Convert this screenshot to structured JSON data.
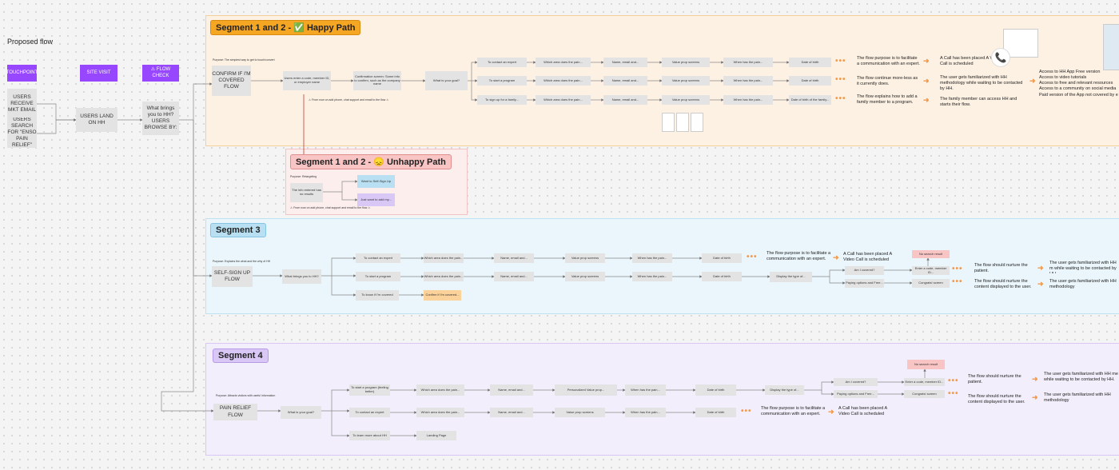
{
  "title": "Proposed flow",
  "lanes": {
    "touchpoint": "TOUCHPOINT",
    "site_visit": "SITE VISIT",
    "flow_check": "⚠ FLOW CHECK"
  },
  "start": {
    "mkt": "USERS RECEIVE MKT EMAIL",
    "search": "USERS SEARCH FOR \"ENSO PAIN RELIEF\"",
    "land": "USERS LAND ON HH",
    "browse": "What brings you to HH? USERS BROWSE BY:"
  },
  "segments": {
    "s12": {
      "title": "Segment 1 and 2 - ✅ Happy Path",
      "purpose": "Purpose: The simplest way to get to touch/convert",
      "entry": "CONFIRM IF I'M COVERED FLOW",
      "n1": "Users enter a code, member ID, or employer name",
      "n2": "Confirmation screen: Some info to confirm, such as the company name",
      "goal": "What is your goal?",
      "warn": "⚠ From now on add phone, chat support and email to the flow ⚠",
      "rows": [
        [
          "To contact an expert",
          "Which area does the pain...",
          "Name, email and...",
          "Value prop screens",
          "When has the pain...",
          "Date of birth"
        ],
        [
          "To start a program",
          "Which area does the pain...",
          "Name, email and...",
          "Value prop screens",
          "When has the pain...",
          "Date of birth"
        ],
        [
          "To sign up for a family...",
          "Which area does the pain...",
          "Name, email and...",
          "Value prop screens",
          "When has the pain...",
          "Date of birth of the family..."
        ]
      ],
      "purpose_notes": [
        "The flow purpose is to facilitate a communication with an expert.",
        "The flow continue more-less as it currently does.",
        "The flow explains how to add a family member to a program."
      ],
      "results": [
        "A Call has been placed A Video Call is scheduled",
        "The user gets familiarized with HH methodology while waiting to be contacted by HH.",
        "The family member can access HH and starts their flow."
      ],
      "access": [
        "Access to HH App Free version",
        "Access to video tutorials",
        "Access to free and relevant resources",
        "Access to a community on social media",
        "Paid version of the App not covered by e"
      ]
    },
    "unhappy": {
      "title": "Segment 1 and 2 - 😞 Unhappy Path",
      "purpose": "Purpose: Retargeting",
      "entry": "The info entered has no results",
      "opt1": "Want to Self-Sign Up",
      "opt2": "Just want to add my...",
      "warn": "⚠ From now on add phone, chat support and email to the flow ⚠"
    },
    "s3": {
      "title": "Segment 3",
      "purpose": "Purpose: Explains the what and the why of HH",
      "entry": "SELF-SIGN UP FLOW",
      "q": "What brings you to HH?",
      "rows": [
        [
          "To contact an expert",
          "Which area does the pain...",
          "Name, email and...",
          "Value prop screens",
          "When has the pain...",
          "Date of birth"
        ],
        [
          "To start a program",
          "Which area does the pain...",
          "Name, email and...",
          "Value prop screens",
          "When has the pain...",
          "Date of birth"
        ]
      ],
      "r3a": "To know if I'm covered",
      "r3b": "Confirm if I'm covered...",
      "display": "Display the type of...",
      "am": "Am I covered?",
      "pay": "Paying options and Free...",
      "nores": "No search result",
      "enter": "Enter a code, member ID...",
      "congrats": "Congrats! screen",
      "note_expert": "The flow purpose is to facilitate a communication with an expert.",
      "result_call": "A Call has been placed A Video Call is scheduled",
      "nurture1": "The flow should nurture the patient.",
      "nurture2": "The flow should nurture the content displayed to the user.",
      "fam1": "The user gets familiarized with HH m while waiting to be contacted by HH.",
      "fam2": "The user gets familiarized with HH methodology"
    },
    "s4": {
      "title": "Segment 4",
      "purpose": "Purpose: Attracts visitors with useful information",
      "entry": "PAIN RELIEF FLOW",
      "q": "What is your goal?",
      "row1": [
        "To start a program (feeling better)",
        "Which area does the pain...",
        "Name, email and...",
        "Personalized Value prop...",
        "When has the pain...",
        "Date of birth"
      ],
      "row2": [
        "To contact an expert",
        "Which area does the pain...",
        "Name, email and...",
        "Value prop screens",
        "When has the pain...",
        "Date of birth"
      ],
      "row3a": "To learn more about HH",
      "row3b": "Landing Page",
      "display": "Display the type of...",
      "am": "Am I covered?",
      "pay": "Paying options and Free...",
      "nores": "No search result",
      "enter": "Enter a code, member ID...",
      "congrats": "Congrats! screen",
      "note_expert": "The flow purpose is to facilitate a communication with an expert.",
      "result_call": "A Call has been placed A Video Call is scheduled",
      "nurture1": "The flow should nurture the patient.",
      "nurture2": "The flow should nurture the content displayed to the user.",
      "fam1": "The user gets familiarized with HH me while waiting to be contacted by HH.",
      "fam2": "The user gets familiarized with HH methodology"
    }
  },
  "colors": {
    "orange_bg": "#fdf1e3",
    "orange_tag": "#f5a623",
    "red_bg": "#fdeeee",
    "red_tag": "#f8c4c4",
    "blue_bg": "#eaf6fb",
    "blue_tag": "#b8e0f2",
    "purple_bg": "#f3eefb",
    "purple_tag": "#d9c7f5",
    "lane": "#9747ff",
    "arrow": "#f2994a"
  }
}
